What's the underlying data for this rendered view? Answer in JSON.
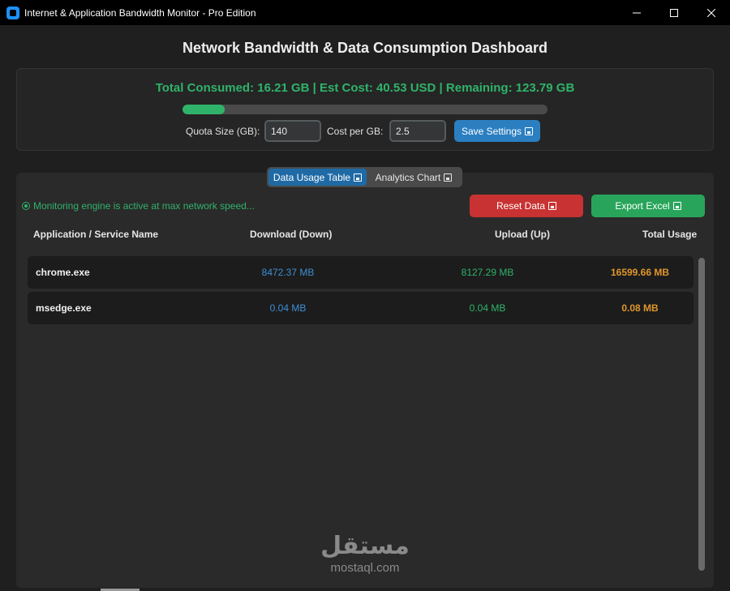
{
  "window": {
    "title": "Internet & Application Bandwidth Monitor - Pro Edition",
    "controls": {
      "minimize": "—",
      "maximize": "☐",
      "close": "✕"
    }
  },
  "dashboard": {
    "title": "Network Bandwidth & Data Consumption Dashboard",
    "summary_text": "Total Consumed: 16.21 GB | Est Cost: 40.53 USD | Remaining: 123.79 GB",
    "quota_progress_fraction": 0.1158,
    "quota_label": "Quota Size (GB):",
    "quota_value": "140",
    "cost_label": "Cost per GB:",
    "cost_value": "2.5",
    "save_button": "Save Settings"
  },
  "tabs": {
    "items": [
      {
        "label": "Data Usage Table",
        "active": true,
        "icon": "table-icon"
      },
      {
        "label": "Analytics Chart",
        "active": false,
        "icon": "chart-icon"
      }
    ]
  },
  "usage": {
    "status": "Monitoring engine is active at max network speed...",
    "reset_button": "Reset Data",
    "export_button": "Export Excel",
    "columns": [
      "Application / Service Name",
      "Download (Down)",
      "Upload (Up)",
      "Total Usage"
    ],
    "rows": [
      {
        "name": "chrome.exe",
        "download": "8472.37 MB",
        "upload": "8127.29 MB",
        "total": "16599.66 MB"
      },
      {
        "name": "msedge.exe",
        "download": "0.04 MB",
        "upload": "0.04 MB",
        "total": "0.08 MB"
      }
    ]
  },
  "watermark": {
    "logo": "مستقل",
    "url": "mostaql.com"
  },
  "colors": {
    "accent_green": "#2fb36a",
    "accent_blue": "#2b7fc1",
    "danger_red": "#c83232",
    "total_orange": "#e0962c"
  }
}
